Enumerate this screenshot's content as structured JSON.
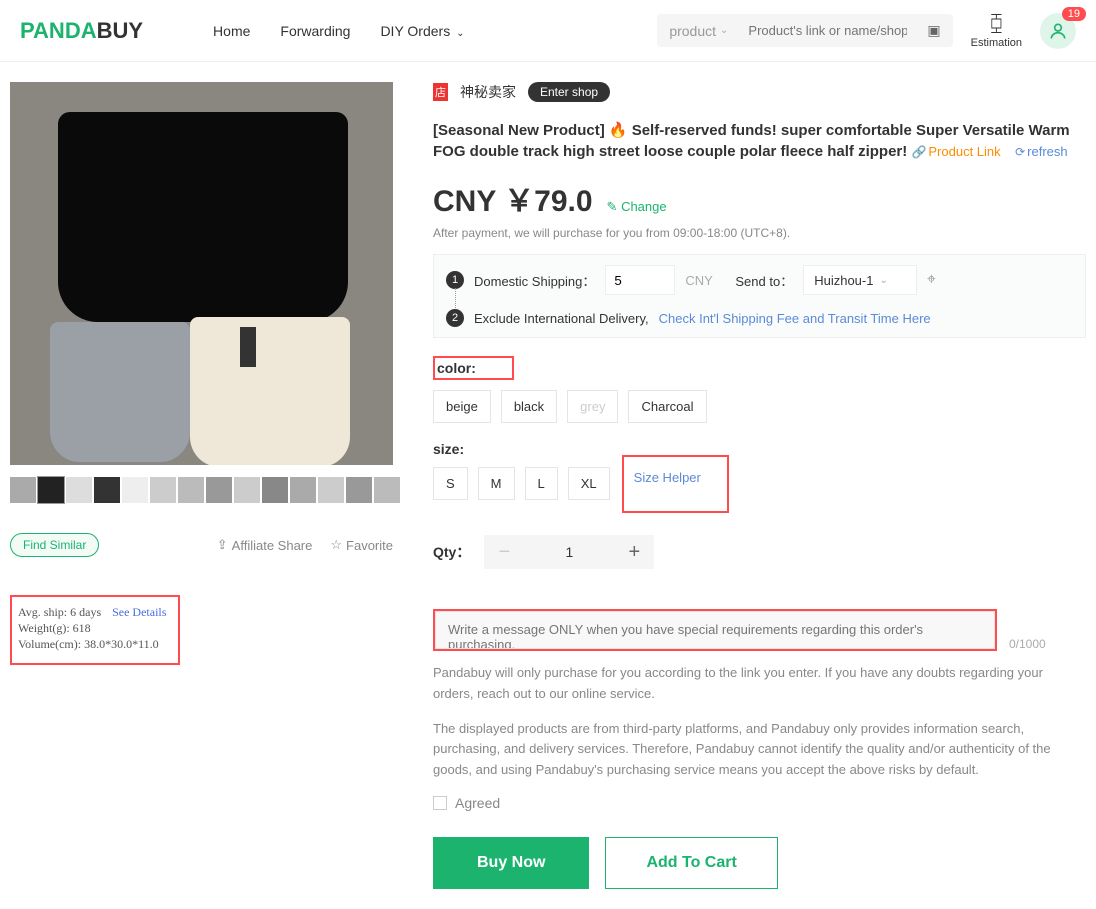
{
  "logo": {
    "p": "PANDA",
    "rest": "BUY"
  },
  "nav": {
    "home": "Home",
    "forwarding": "Forwarding",
    "diy": "DIY Orders"
  },
  "search": {
    "type": "product",
    "placeholder": "Product's link or name/shop's li"
  },
  "estimation": "Estimation",
  "notif_count": "19",
  "shop": {
    "badge": "店",
    "name": "神秘卖家",
    "enter": "Enter shop"
  },
  "title_main": "[Seasonal New Product] 🔥 Self-reserved funds! super comfortable Super Versatile Warm FOG double track high street loose couple polar fleece half zipper!",
  "title_links": {
    "product": "Product Link",
    "refresh": "refresh"
  },
  "price": {
    "currency": "CNY ￥",
    "amount": "79.0",
    "change": "Change"
  },
  "after_payment": "After payment, we will purchase for you from 09:00-18:00 (UTC+8).",
  "shipping": {
    "label1": "Domestic Shipping：",
    "fee": "5",
    "cny": "CNY",
    "sendto": "Send to：",
    "dest": "Huizhou-1",
    "label2": "Exclude International Delivery,",
    "intl_link": "Check Int'l Shipping Fee and Transit Time Here"
  },
  "color": {
    "label": "color:",
    "options": [
      "beige",
      "black",
      "grey",
      "Charcoal"
    ]
  },
  "size": {
    "label": "size:",
    "options": [
      "S",
      "M",
      "L",
      "XL"
    ],
    "helper": "Size Helper"
  },
  "qty": {
    "label": "Qty：",
    "value": "1"
  },
  "msg_placeholder": "Write a message ONLY when you have special requirements regarding this order's purchasing.",
  "msg_count": "0/1000",
  "disclaimer1": "Pandabuy will only purchase for you according to the link you enter. If you have any doubts regarding your orders, reach out to our online service.",
  "disclaimer2": "The displayed products are from third-party platforms, and Pandabuy only provides information search, purchasing, and delivery services. Therefore, Pandabuy cannot identify the quality and/or authenticity of the goods, and using Pandabuy's purchasing service means you accept the above risks by default.",
  "agreed": "Agreed",
  "buy_now": "Buy Now",
  "add_cart": "Add To Cart",
  "find_similar": "Find Similar",
  "affiliate": "Affiliate Share",
  "favorite": "Favorite",
  "ship_info": {
    "avg": "Avg. ship: 6 days",
    "see": "See Details",
    "weight": "Weight(g): 618",
    "volume": "Volume(cm): 38.0*30.0*11.0"
  }
}
